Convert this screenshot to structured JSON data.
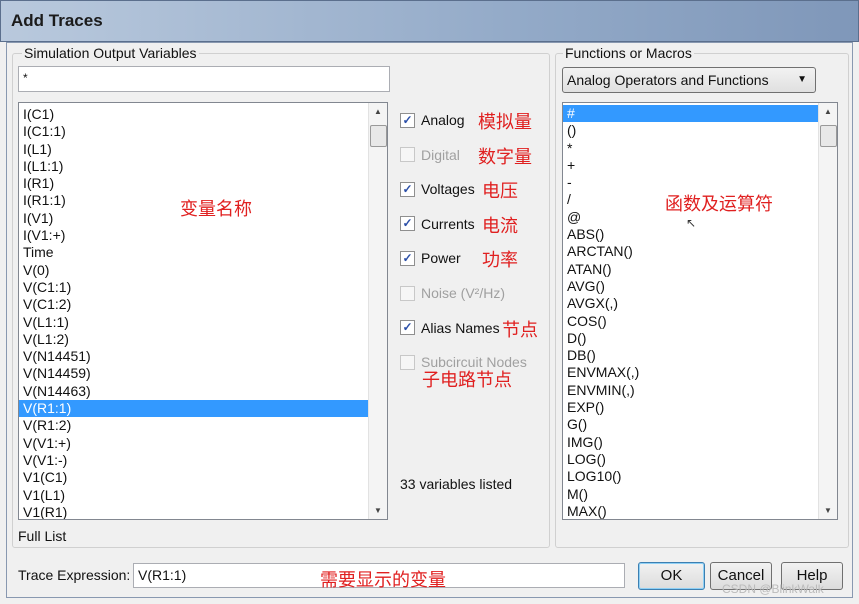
{
  "window": {
    "title": "Add Traces"
  },
  "left": {
    "group_label": "Simulation Output Variables",
    "filter_value": "*",
    "items": [
      "I(C1)",
      "I(C1:1)",
      "I(L1)",
      "I(L1:1)",
      "I(R1)",
      "I(R1:1)",
      "I(V1)",
      "I(V1:+)",
      "Time",
      "V(0)",
      "V(C1:1)",
      "V(C1:2)",
      "V(L1:1)",
      "V(L1:2)",
      "V(N14451)",
      "V(N14459)",
      "V(N14463)",
      "V(R1:1)",
      "V(R1:2)",
      "V(V1:+)",
      "V(V1:-)",
      "V1(C1)",
      "V1(L1)",
      "V1(R1)"
    ],
    "selected": "V(R1:1)",
    "footer": "Full List"
  },
  "options": [
    {
      "label": "Analog",
      "checked": true,
      "enabled": true,
      "note": "模拟量"
    },
    {
      "label": "Digital",
      "checked": false,
      "enabled": false,
      "note": "数字量"
    },
    {
      "label": "Voltages",
      "checked": true,
      "enabled": true,
      "note": "电压"
    },
    {
      "label": "Currents",
      "checked": true,
      "enabled": true,
      "note": "电流"
    },
    {
      "label": "Power",
      "checked": true,
      "enabled": true,
      "note": "功率"
    },
    {
      "label": "Noise (V²/Hz)",
      "checked": false,
      "enabled": false,
      "note": ""
    },
    {
      "label": "Alias Names",
      "checked": true,
      "enabled": true,
      "note": "节点"
    },
    {
      "label": "Subcircuit Nodes",
      "checked": false,
      "enabled": false,
      "note": "子电路节点"
    }
  ],
  "count_text": "33 variables listed",
  "right": {
    "group_label": "Functions or Macros",
    "combo_value": "Analog Operators and Functions",
    "items": [
      "#",
      "()",
      "*",
      "+",
      "-",
      "/",
      "@",
      "ABS()",
      "ARCTAN()",
      "ATAN()",
      "AVG()",
      "AVGX(,)",
      "COS()",
      "D()",
      "DB()",
      "ENVMAX(,)",
      "ENVMIN(,)",
      "EXP()",
      "G()",
      "IMG()",
      "LOG()",
      "LOG10()",
      "M()",
      "MAX()"
    ],
    "selected": "#"
  },
  "annotations": {
    "variables": "变量名称",
    "functions": "函数及运算符",
    "expression": "需要显示的变量"
  },
  "bottom": {
    "expr_label": "Trace Expression:",
    "expr_value": "V(R1:1)",
    "ok": "OK",
    "cancel": "Cancel",
    "help": "Help"
  },
  "watermark": "CSDN @BlinkWalk",
  "colors": {
    "selection": "#3399ff",
    "annotation": "#e02020"
  }
}
